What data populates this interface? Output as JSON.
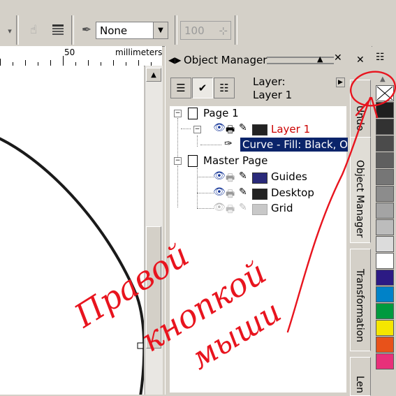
{
  "toolbar": {
    "outline_value": "None",
    "number_value": "100",
    "icons": [
      "dropdown-arrow-icon",
      "shape-tool-icon",
      "wrap-text-icon",
      "pen-outline-icon",
      "spin-arrows-icon"
    ]
  },
  "ruler": {
    "label_50": "50",
    "units": "millimeters"
  },
  "object_manager": {
    "title": "Object Manager",
    "layer_label_line1": "Layer:",
    "layer_label_line2": "Layer 1",
    "tree": {
      "page1": "Page 1",
      "layer1": "Layer 1",
      "curve": "Curve - Fill: Black, O",
      "master_page": "Master Page",
      "guides": "Guides",
      "desktop": "Desktop",
      "grid": "Grid"
    },
    "colors": {
      "layer1_text": "#cc0000",
      "layer1_swatch": "#222222",
      "guides_swatch": "#2a2a7a",
      "desktop_swatch": "#222222",
      "grid_swatch": "#c8c8c8",
      "selection": "#0a246a"
    }
  },
  "docker_tabs": {
    "undo": "Undo",
    "object_manager": "Object Manager",
    "transformation": "Transformation",
    "lens": "Len"
  },
  "palette": {
    "colors": [
      "#1f1f1f",
      "#323232",
      "#4b4b4b",
      "#5f5f5f",
      "#767676",
      "#8c8c8c",
      "#a4a4a4",
      "#bcbcbc",
      "#dcdcdc",
      "#ffffff",
      "#2c1a84",
      "#0082c8",
      "#009a3e",
      "#f5e600",
      "#e8521a",
      "#e8307a"
    ]
  },
  "annotation": {
    "handwriting_line1": "Правой",
    "handwriting_line2": "кнопкой",
    "handwriting_line3": "мыши",
    "color": "#e8141e"
  }
}
